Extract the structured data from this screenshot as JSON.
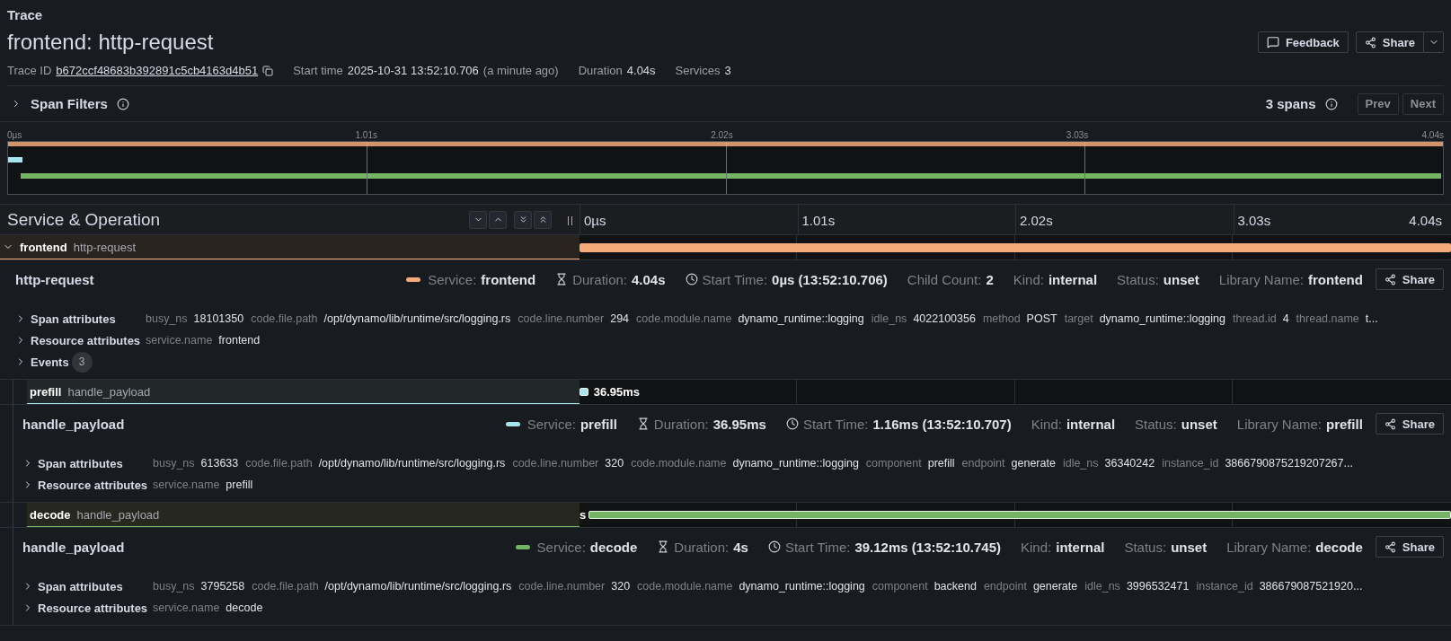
{
  "breadcrumb": "Trace",
  "title": "frontend: http-request",
  "meta": [
    {
      "kind": "link",
      "label": "Trace ID",
      "value": "b672ccf48683b392891c5cb4163d4b51"
    },
    {
      "kind": "text",
      "label": "Start time",
      "value": "2025-10-31 13:52:10.706",
      "note": "(a minute ago)"
    },
    {
      "kind": "text",
      "label": "Duration",
      "value": "4.04s"
    },
    {
      "kind": "text",
      "label": "Services",
      "value": "3"
    }
  ],
  "actions": {
    "feedback": "Feedback",
    "share": "Share"
  },
  "span_filters": {
    "label": "Span Filters",
    "expanded": false
  },
  "span_count": "3 spans",
  "nav": [
    "Prev",
    "Next"
  ],
  "minimap_ticks": [
    "0µs",
    "1.01s",
    "2.02s",
    "3.03s",
    "4.04s"
  ],
  "column_title": "Service & Operation",
  "timeline_ticks": [
    "0µs",
    "1.01s",
    "2.02s",
    "3.03s",
    "4.04s"
  ],
  "spans": [
    {
      "service": "frontend",
      "operation": "http-request",
      "color": "#f5aa7a",
      "level": 1,
      "expanded": true,
      "details": {
        "title": "http-request",
        "share": "Share",
        "fields": [
          {
            "kind": "swatch",
            "label": "Service:",
            "value": "frontend"
          },
          {
            "kind": "hourglass",
            "label": "Duration:",
            "value": "4.04s"
          },
          {
            "kind": "clock",
            "label": "Start Time:",
            "value": "0µs (13:52:10.706)"
          },
          {
            "kind": "plain",
            "label": "Child Count:",
            "value": "2"
          },
          {
            "kind": "plain",
            "label": "Kind:",
            "value": "internal"
          },
          {
            "kind": "plain",
            "label": "Status:",
            "value": "unset"
          },
          {
            "kind": "plain",
            "label": "Library Name:",
            "value": "frontend"
          }
        ],
        "sections": [
          {
            "label": "Span attributes",
            "expanded": false,
            "items": [
              {
                "key": "busy_ns",
                "value": "18101350"
              },
              {
                "key": "code.file.path",
                "value": "/opt/dynamo/lib/runtime/src/logging.rs"
              },
              {
                "key": "code.line.number",
                "value": "294"
              },
              {
                "key": "code.module.name",
                "value": "dynamo_runtime::logging"
              },
              {
                "key": "idle_ns",
                "value": "4022100356"
              },
              {
                "key": "method",
                "value": "POST"
              },
              {
                "key": "target",
                "value": "dynamo_runtime::logging"
              },
              {
                "key": "thread.id",
                "value": "4"
              },
              {
                "key": "thread.name",
                "value": "t..."
              }
            ]
          },
          {
            "label": "Resource attributes",
            "expanded": false,
            "items": [
              {
                "key": "service.name",
                "value": "frontend"
              }
            ]
          },
          {
            "label": "Events",
            "expanded": false,
            "count": "3"
          }
        ]
      },
      "children": [
        {
          "service": "prefill",
          "operation": "handle_payload",
          "color": "#a8e4ee",
          "level": 0.01,
          "bar_label": "36.95ms",
          "details": {
            "title": "handle_payload",
            "share": "Share",
            "fields": [
              {
                "kind": "swatch",
                "label": "Service:",
                "value": "prefill"
              },
              {
                "kind": "hourglass",
                "label": "Duration:",
                "value": "36.95ms"
              },
              {
                "kind": "clock",
                "label": "Start Time:",
                "value": "1.16ms (13:52:10.707)"
              },
              {
                "kind": "plain",
                "label": "Kind:",
                "value": "internal"
              },
              {
                "kind": "plain",
                "label": "Status:",
                "value": "unset"
              },
              {
                "kind": "plain",
                "label": "Library Name:",
                "value": "prefill"
              }
            ],
            "sections": [
              {
                "label": "Span attributes",
                "expanded": false,
                "items": [
                  {
                    "key": "busy_ns",
                    "value": "613633"
                  },
                  {
                    "key": "code.file.path",
                    "value": "/opt/dynamo/lib/runtime/src/logging.rs"
                  },
                  {
                    "key": "code.line.number",
                    "value": "320"
                  },
                  {
                    "key": "code.module.name",
                    "value": "dynamo_runtime::logging"
                  },
                  {
                    "key": "component",
                    "value": "prefill"
                  },
                  {
                    "key": "endpoint",
                    "value": "generate"
                  },
                  {
                    "key": "idle_ns",
                    "value": "36340242"
                  },
                  {
                    "key": "instance_id",
                    "value": "3866790875219207267..."
                  }
                ]
              },
              {
                "label": "Resource attributes",
                "expanded": false,
                "items": [
                  {
                    "key": "service.name",
                    "value": "prefill"
                  }
                ]
              }
            ]
          }
        },
        {
          "service": "decode",
          "operation": "handle_payload",
          "color": "#73b562",
          "level": 0.99,
          "bar_label": "s",
          "details": {
            "title": "handle_payload",
            "share": "Share",
            "fields": [
              {
                "kind": "swatch",
                "label": "Service:",
                "value": "decode"
              },
              {
                "kind": "hourglass",
                "label": "Duration:",
                "value": "4s"
              },
              {
                "kind": "clock",
                "label": "Start Time:",
                "value": "39.12ms (13:52:10.745)"
              },
              {
                "kind": "plain",
                "label": "Kind:",
                "value": "internal"
              },
              {
                "kind": "plain",
                "label": "Status:",
                "value": "unset"
              },
              {
                "kind": "plain",
                "label": "Library Name:",
                "value": "decode"
              }
            ],
            "sections": [
              {
                "label": "Span attributes",
                "expanded": false,
                "items": [
                  {
                    "key": "busy_ns",
                    "value": "3795258"
                  },
                  {
                    "key": "code.file.path",
                    "value": "/opt/dynamo/lib/runtime/src/logging.rs"
                  },
                  {
                    "key": "code.line.number",
                    "value": "320"
                  },
                  {
                    "key": "code.module.name",
                    "value": "dynamo_runtime::logging"
                  },
                  {
                    "key": "component",
                    "value": "backend"
                  },
                  {
                    "key": "endpoint",
                    "value": "generate"
                  },
                  {
                    "key": "idle_ns",
                    "value": "3996532471"
                  },
                  {
                    "key": "instance_id",
                    "value": "386679087521920..."
                  }
                ]
              },
              {
                "label": "Resource attributes",
                "expanded": false,
                "items": [
                  {
                    "key": "service.name",
                    "value": "decode"
                  }
                ]
              }
            ]
          }
        }
      ]
    }
  ]
}
